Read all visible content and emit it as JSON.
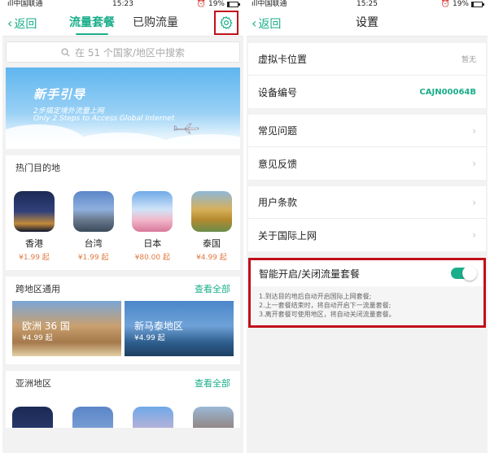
{
  "status_left": {
    "carrier": "中国联通",
    "time": "15:23",
    "battery": "19%",
    "battery_level": 0.19
  },
  "status_right": {
    "carrier": "中国联通",
    "time": "15:25",
    "battery": "19%",
    "battery_level": 0.19
  },
  "left_nav": {
    "back": "返回",
    "tabs": [
      {
        "label": "流量套餐",
        "active": true
      },
      {
        "label": "已购流量",
        "active": false
      }
    ],
    "settings_icon": "gear-icon"
  },
  "search": {
    "placeholder": "在 51 个国家/地区中搜索"
  },
  "banner": {
    "title": "新手引导",
    "subtitle_cn": "2步搞定境外流量上网",
    "subtitle_en": "Only 2 Steps to Access Global Internet"
  },
  "hot": {
    "title": "热门目的地",
    "items": [
      {
        "name": "香港",
        "price": "¥1.99 起"
      },
      {
        "name": "台湾",
        "price": "¥1.99 起"
      },
      {
        "name": "日本",
        "price": "¥80.00 起"
      },
      {
        "name": "泰国",
        "price": "¥4.99 起"
      }
    ]
  },
  "cross": {
    "title": "跨地区通用",
    "more": "查看全部",
    "items": [
      {
        "name": "欧洲 36 国",
        "price": "¥4.99 起"
      },
      {
        "name": "新马泰地区",
        "price": "¥4.99 起"
      }
    ]
  },
  "asia": {
    "title": "亚洲地区",
    "more": "查看全部"
  },
  "right_nav": {
    "back": "返回",
    "title": "设置"
  },
  "settings": {
    "group1": [
      {
        "label": "虚拟卡位置",
        "value": "暂无"
      },
      {
        "label": "设备编号",
        "value": "CAJN00064B"
      }
    ],
    "group2": [
      {
        "label": "常见问题"
      },
      {
        "label": "意见反馈"
      }
    ],
    "group3": [
      {
        "label": "用户条款"
      },
      {
        "label": "关于国际上网"
      }
    ],
    "auto_switch": {
      "label": "智能开启/关闭流量套餐",
      "enabled": true,
      "notes": [
        "1.到达目的地后自动开启国际上网套餐;",
        "2.上一套餐结束时，将自动开启下一流量套餐;",
        "3.离开套餐可使用地区，将自动关闭流量套餐。"
      ]
    }
  },
  "colors": {
    "accent": "#1aae8a",
    "highlight": "#c0101a",
    "price": "#e07a40"
  }
}
